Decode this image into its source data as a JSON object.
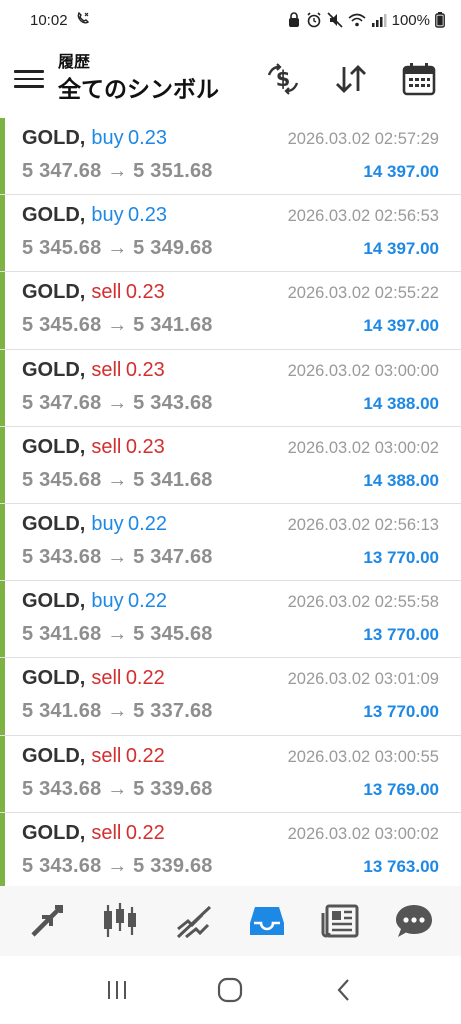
{
  "status_bar": {
    "time": "10:02",
    "battery": "100%"
  },
  "header": {
    "title": "履歴",
    "subtitle": "全てのシンボル"
  },
  "trades": [
    {
      "symbol": "GOLD",
      "side": "buy",
      "volume": "0.23",
      "open_price": "5 347.68",
      "close_price": "5 351.68",
      "time": "2026.03.02 02:57:29",
      "profit": "14 397.00"
    },
    {
      "symbol": "GOLD",
      "side": "buy",
      "volume": "0.23",
      "open_price": "5 345.68",
      "close_price": "5 349.68",
      "time": "2026.03.02 02:56:53",
      "profit": "14 397.00"
    },
    {
      "symbol": "GOLD",
      "side": "sell",
      "volume": "0.23",
      "open_price": "5 345.68",
      "close_price": "5 341.68",
      "time": "2026.03.02 02:55:22",
      "profit": "14 397.00"
    },
    {
      "symbol": "GOLD",
      "side": "sell",
      "volume": "0.23",
      "open_price": "5 347.68",
      "close_price": "5 343.68",
      "time": "2026.03.02 03:00:00",
      "profit": "14 388.00"
    },
    {
      "symbol": "GOLD",
      "side": "sell",
      "volume": "0.23",
      "open_price": "5 345.68",
      "close_price": "5 341.68",
      "time": "2026.03.02 03:00:02",
      "profit": "14 388.00"
    },
    {
      "symbol": "GOLD",
      "side": "buy",
      "volume": "0.22",
      "open_price": "5 343.68",
      "close_price": "5 347.68",
      "time": "2026.03.02 02:56:13",
      "profit": "13 770.00"
    },
    {
      "symbol": "GOLD",
      "side": "buy",
      "volume": "0.22",
      "open_price": "5 341.68",
      "close_price": "5 345.68",
      "time": "2026.03.02 02:55:58",
      "profit": "13 770.00"
    },
    {
      "symbol": "GOLD",
      "side": "sell",
      "volume": "0.22",
      "open_price": "5 341.68",
      "close_price": "5 337.68",
      "time": "2026.03.02 03:01:09",
      "profit": "13 770.00"
    },
    {
      "symbol": "GOLD",
      "side": "sell",
      "volume": "0.22",
      "open_price": "5 343.68",
      "close_price": "5 339.68",
      "time": "2026.03.02 03:00:55",
      "profit": "13 769.00"
    },
    {
      "symbol": "GOLD",
      "side": "sell",
      "volume": "0.22",
      "open_price": "5 343.68",
      "close_price": "5 339.68",
      "time": "2026.03.02 03:00:02",
      "profit": "13 763.00"
    }
  ],
  "colors": {
    "buy": "#1e88e5",
    "sell": "#d32f2f",
    "profit": "#1e88e5",
    "row_accent": "#7cb342",
    "nav_active": "#1e88e5"
  },
  "bottom_nav": {
    "items": [
      {
        "icon": "quotes-arrows-icon",
        "active": false
      },
      {
        "icon": "candlestick-chart-icon",
        "active": false
      },
      {
        "icon": "trade-trend-icon",
        "active": false
      },
      {
        "icon": "history-inbox-icon",
        "active": true
      },
      {
        "icon": "news-icon",
        "active": false
      },
      {
        "icon": "chat-icon",
        "active": false
      }
    ]
  },
  "app_actions": [
    "dollar-exchange-icon",
    "sort-icon",
    "calendar-icon"
  ],
  "system_nav": [
    "recent-apps-icon",
    "home-icon",
    "back-icon"
  ]
}
